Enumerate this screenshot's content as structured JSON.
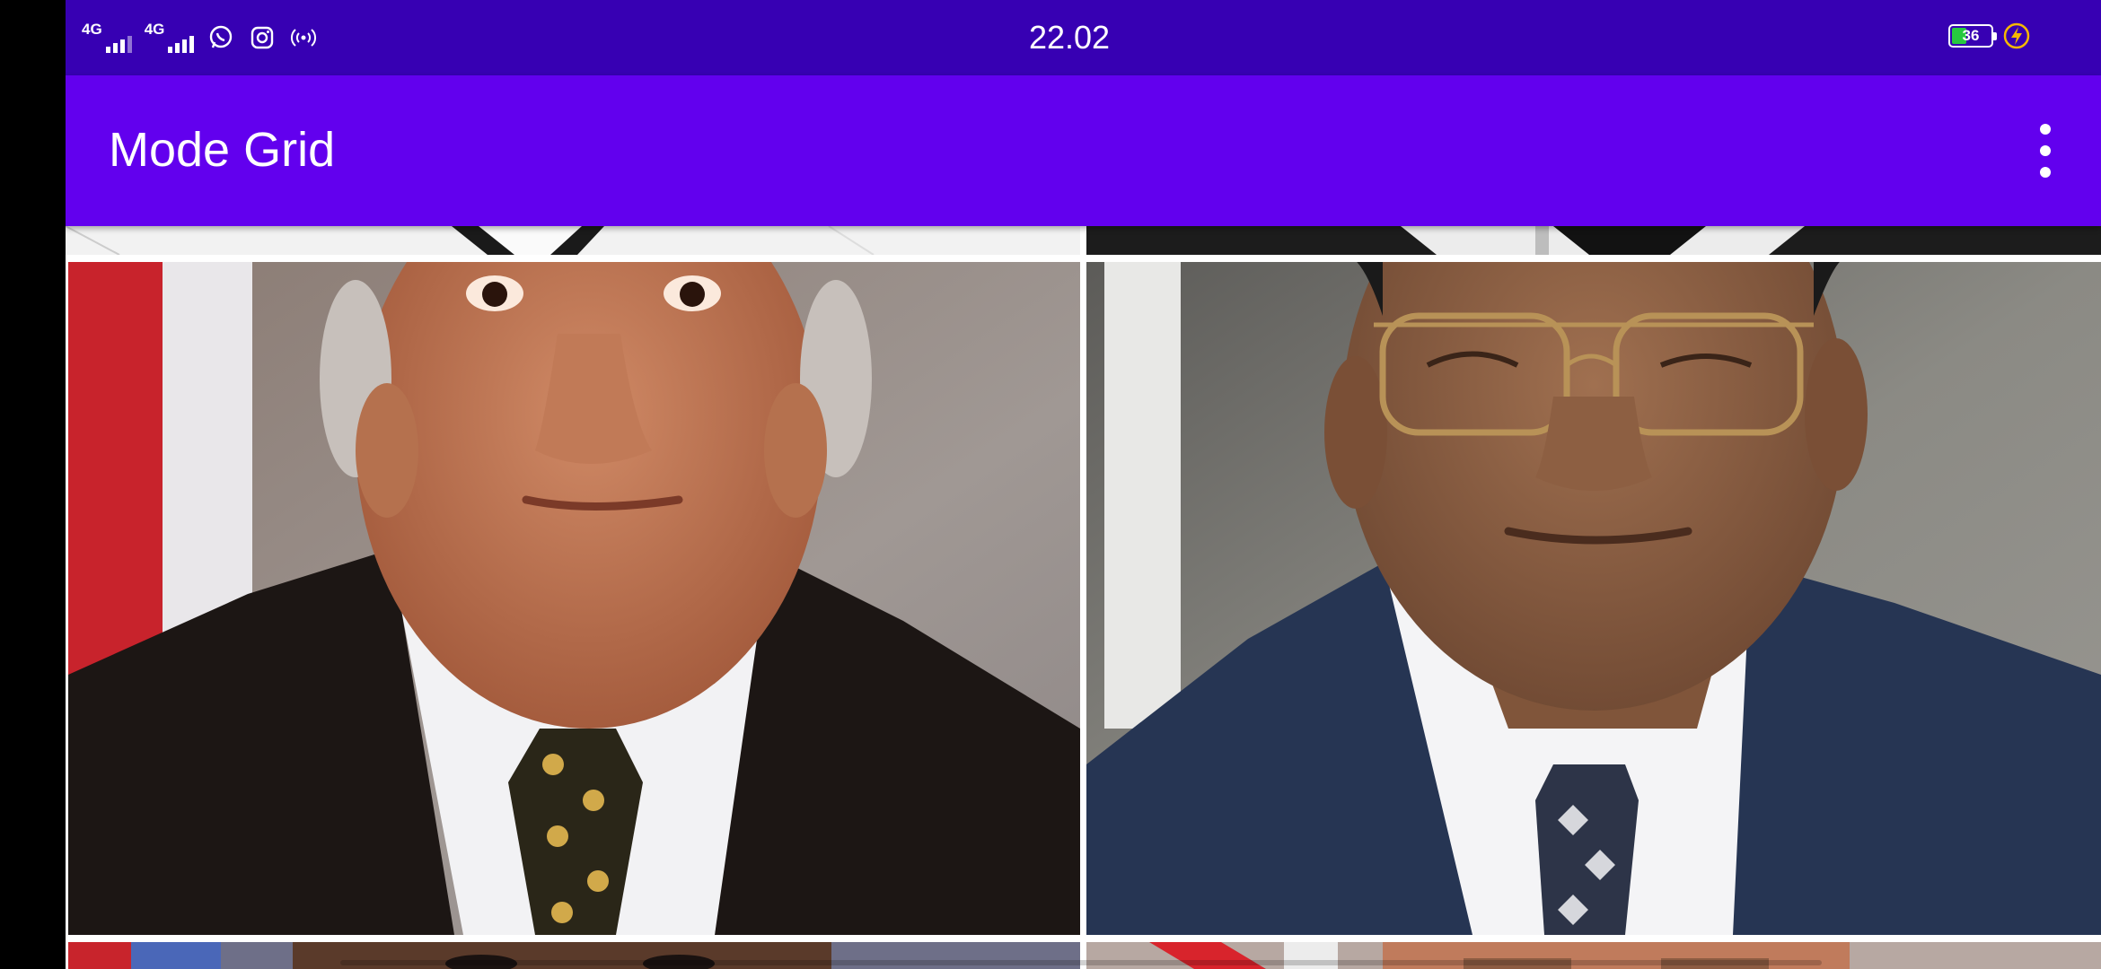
{
  "status_bar": {
    "time": "22.02",
    "network_1": "4G",
    "network_2": "4G",
    "battery_level": "36",
    "icons": [
      "whatsapp-icon",
      "instagram-icon",
      "hotspot-icon",
      "battery-icon",
      "charging-icon"
    ]
  },
  "app_bar": {
    "title": "Mode Grid",
    "menu_icon": "more-vert-icon"
  },
  "colors": {
    "status_bar": "#3700B3",
    "app_bar": "#6200EE",
    "battery_fill": "#27c93f",
    "charging": "#F5B800"
  },
  "grid": {
    "columns": 2,
    "items": [
      {
        "name": "partial-top-left"
      },
      {
        "name": "partial-top-right"
      },
      {
        "name": "portrait-man-dark-suit-patterned-tie"
      },
      {
        "name": "portrait-man-glasses-blue-suit"
      },
      {
        "name": "partial-bottom-left"
      },
      {
        "name": "partial-bottom-right"
      }
    ]
  }
}
